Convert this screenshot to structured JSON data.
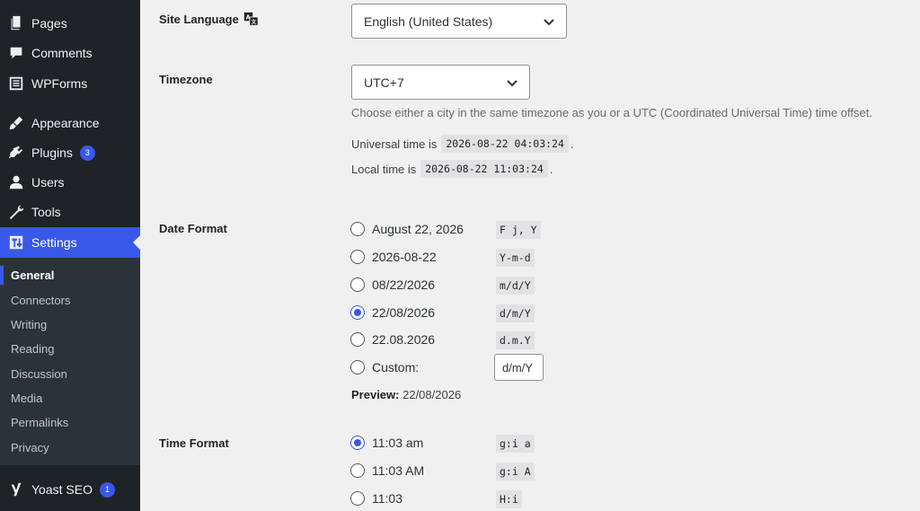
{
  "sidebar": {
    "menu": [
      {
        "label": "Pages",
        "icon": "pages-icon"
      },
      {
        "label": "Comments",
        "icon": "comments-icon"
      },
      {
        "label": "WPForms",
        "icon": "wpforms-icon"
      },
      {
        "label": "Appearance",
        "icon": "appearance-icon"
      },
      {
        "label": "Plugins",
        "icon": "plugins-icon",
        "badge": "3"
      },
      {
        "label": "Users",
        "icon": "users-icon"
      },
      {
        "label": "Tools",
        "icon": "tools-icon"
      },
      {
        "label": "Settings",
        "icon": "settings-icon"
      },
      {
        "label": "Yoast SEO",
        "icon": "yoast-icon",
        "badge": "1"
      }
    ],
    "submenu": [
      "General",
      "Connectors",
      "Writing",
      "Reading",
      "Discussion",
      "Media",
      "Permalinks",
      "Privacy"
    ]
  },
  "settings": {
    "site_language": {
      "label": "Site Language",
      "value": "English (United States)"
    },
    "timezone": {
      "label": "Timezone",
      "value": "UTC+7",
      "description": "Choose either a city in the same timezone as you or a UTC (Coordinated Universal Time) time offset.",
      "universal_prefix": "Universal time is",
      "universal_time": "2026-08-22 04:03:24",
      "local_prefix": "Local time is",
      "local_time": "2026-08-22 11:03:24",
      "period": "."
    },
    "date_format": {
      "label": "Date Format",
      "options": [
        {
          "label": "August 22, 2026",
          "code": "F j, Y",
          "checked": false
        },
        {
          "label": "2026-08-22",
          "code": "Y-m-d",
          "checked": false
        },
        {
          "label": "08/22/2026",
          "code": "m/d/Y",
          "checked": false
        },
        {
          "label": "22/08/2026",
          "code": "d/m/Y",
          "checked": true
        },
        {
          "label": "22.08.2026",
          "code": "d.m.Y",
          "checked": false
        },
        {
          "label": "Custom:",
          "checked": false
        }
      ],
      "custom_value": "d/m/Y",
      "preview_label": "Preview:",
      "preview_value": "22/08/2026"
    },
    "time_format": {
      "label": "Time Format",
      "options": [
        {
          "label": "11:03 am",
          "code": "g:i a",
          "checked": true
        },
        {
          "label": "11:03 AM",
          "code": "g:i A",
          "checked": false
        },
        {
          "label": "11:03",
          "code": "H:i",
          "checked": false
        }
      ]
    }
  },
  "colors": {
    "accent": "#3858e9",
    "sidebar": "#1d2327",
    "submenu": "#2c3338",
    "background": "#f0f0f1"
  }
}
